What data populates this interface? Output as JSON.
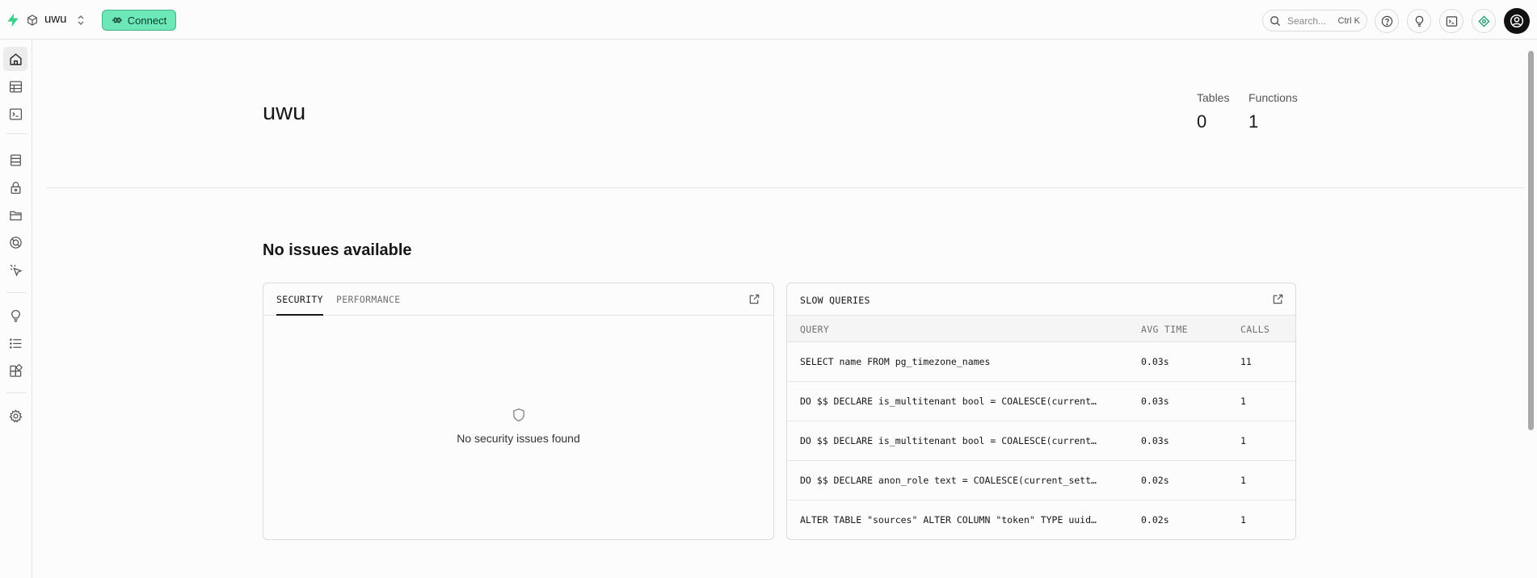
{
  "topbar": {
    "project_name": "uwu",
    "connect_label": "Connect",
    "search_placeholder": "Search...",
    "search_shortcut": "Ctrl K",
    "icons": [
      "bolt-logo-icon",
      "cube-icon",
      "chevron-updown-icon",
      "plug-icon",
      "search-icon",
      "help-icon",
      "lightbulb-icon",
      "terminal-icon",
      "assistant-icon",
      "user-avatar-icon"
    ],
    "accent_color": "#6ee7b7"
  },
  "sidebar": {
    "items": [
      {
        "name": "home",
        "icon": "home-icon",
        "active": true
      },
      {
        "name": "table-editor",
        "icon": "table-icon"
      },
      {
        "name": "sql-editor",
        "icon": "terminal-icon"
      },
      {
        "name": "database",
        "icon": "database-icon"
      },
      {
        "name": "authentication",
        "icon": "lock-icon"
      },
      {
        "name": "storage",
        "icon": "storage-icon"
      },
      {
        "name": "realtime",
        "icon": "realtime-icon"
      },
      {
        "name": "edge-functions",
        "icon": "cursor-icon"
      },
      {
        "name": "advisors",
        "icon": "lightbulb-icon"
      },
      {
        "name": "logs",
        "icon": "list-icon"
      },
      {
        "name": "integrations",
        "icon": "blocks-icon"
      },
      {
        "name": "settings",
        "icon": "gear-icon"
      }
    ]
  },
  "main": {
    "title": "uwu",
    "stats": [
      {
        "label": "Tables",
        "value": "0"
      },
      {
        "label": "Functions",
        "value": "1"
      }
    ],
    "issues_title": "No issues available",
    "security_card": {
      "tabs": [
        "SECURITY",
        "PERFORMANCE"
      ],
      "active_tab": "SECURITY",
      "empty_message": "No security issues found"
    },
    "slow_queries": {
      "title": "SLOW QUERIES",
      "columns": [
        "QUERY",
        "AVG TIME",
        "CALLS"
      ],
      "rows": [
        {
          "query": "SELECT name FROM pg_timezone_names",
          "avg_time": "0.03s",
          "calls": "11"
        },
        {
          "query": "DO $$ DECLARE is_multitenant bool = COALESCE(current…",
          "avg_time": "0.03s",
          "calls": "1"
        },
        {
          "query": "DO $$ DECLARE is_multitenant bool = COALESCE(current…",
          "avg_time": "0.03s",
          "calls": "1"
        },
        {
          "query": "DO $$ DECLARE anon_role text = COALESCE(current_sett…",
          "avg_time": "0.02s",
          "calls": "1"
        },
        {
          "query": "ALTER TABLE \"sources\" ALTER COLUMN \"token\" TYPE uuid…",
          "avg_time": "0.02s",
          "calls": "1"
        }
      ]
    }
  }
}
